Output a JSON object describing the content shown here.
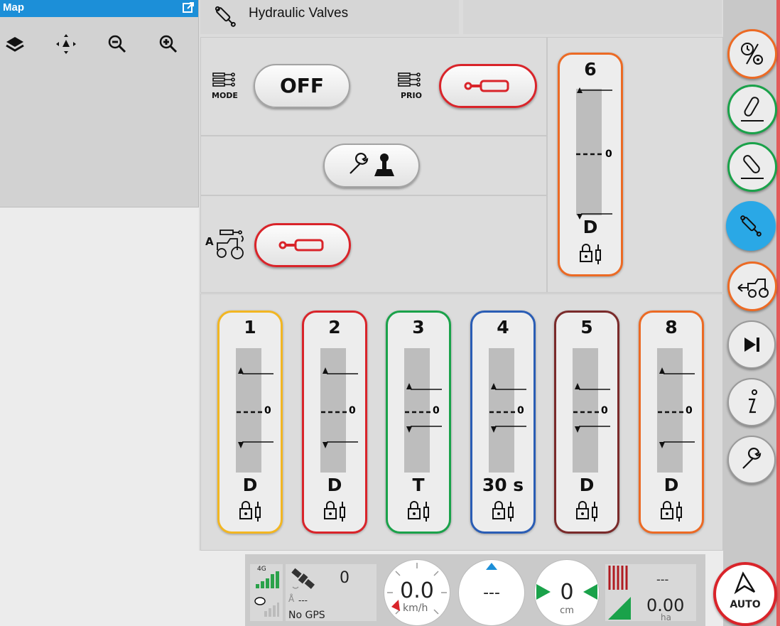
{
  "map": {
    "title": "Map"
  },
  "header": {
    "title": "Hydraulic Valves"
  },
  "controls": {
    "mode_label": "MODE",
    "mode_value": "OFF",
    "prio_label": "PRIO",
    "auto_letter": "A"
  },
  "valve6": {
    "number": "6",
    "mode": "D",
    "zero": "0"
  },
  "valves": [
    {
      "number": "1",
      "mode": "D",
      "zero": "0",
      "color": "#f2b622"
    },
    {
      "number": "2",
      "mode": "D",
      "zero": "0",
      "color": "#d9242a"
    },
    {
      "number": "3",
      "mode": "T",
      "zero": "0",
      "color": "#1aa24a"
    },
    {
      "number": "4",
      "mode": "30 s",
      "zero": "0",
      "color": "#2a5db5"
    },
    {
      "number": "5",
      "mode": "D",
      "zero": "0",
      "color": "#7a2a2a"
    },
    {
      "number": "8",
      "mode": "D",
      "zero": "0",
      "color": "#ec6a24"
    }
  ],
  "colors": {
    "map_header": "#1c8fd8",
    "active_sidebar": "#2aa8e6",
    "valve6": "#ec6a24"
  },
  "status": {
    "network_label": "4G",
    "satellites": "0",
    "gps_value": "---",
    "gps_status": "No GPS",
    "speed": "0.0",
    "speed_unit": "km/h",
    "heading": "---",
    "offset": "0",
    "offset_unit": "cm",
    "area_top": "---",
    "area": "0.00",
    "area_unit": "ha",
    "auto_label": "AUTO"
  }
}
